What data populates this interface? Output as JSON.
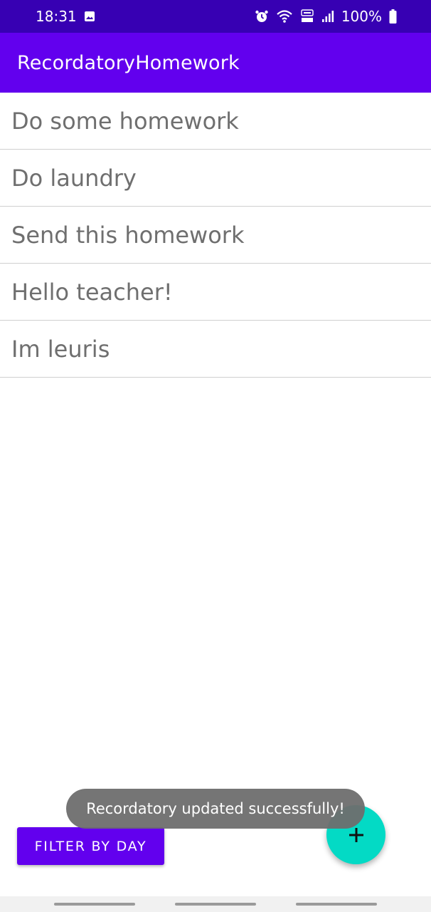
{
  "status_bar": {
    "time": "18:31",
    "battery": "100%",
    "icons": [
      "gallery-icon",
      "alarm-icon",
      "wifi-icon",
      "volte-icon",
      "signal-icon",
      "battery-icon"
    ]
  },
  "app_bar": {
    "title": "RecordatoryHomework"
  },
  "tasks": [
    {
      "label": "Do some homework"
    },
    {
      "label": "Do laundry"
    },
    {
      "label": "Send this homework"
    },
    {
      "label": "Hello teacher!"
    },
    {
      "label": "Im leuris"
    }
  ],
  "toast": {
    "message": "Recordatory updated successfully!"
  },
  "actions": {
    "filter_label": "FILTER BY DAY",
    "fab_icon": "plus-icon"
  },
  "colors": {
    "status_bar": "#3700b3",
    "primary": "#6200ee",
    "accent": "#03dac5",
    "toast": "#6e6e6e"
  }
}
